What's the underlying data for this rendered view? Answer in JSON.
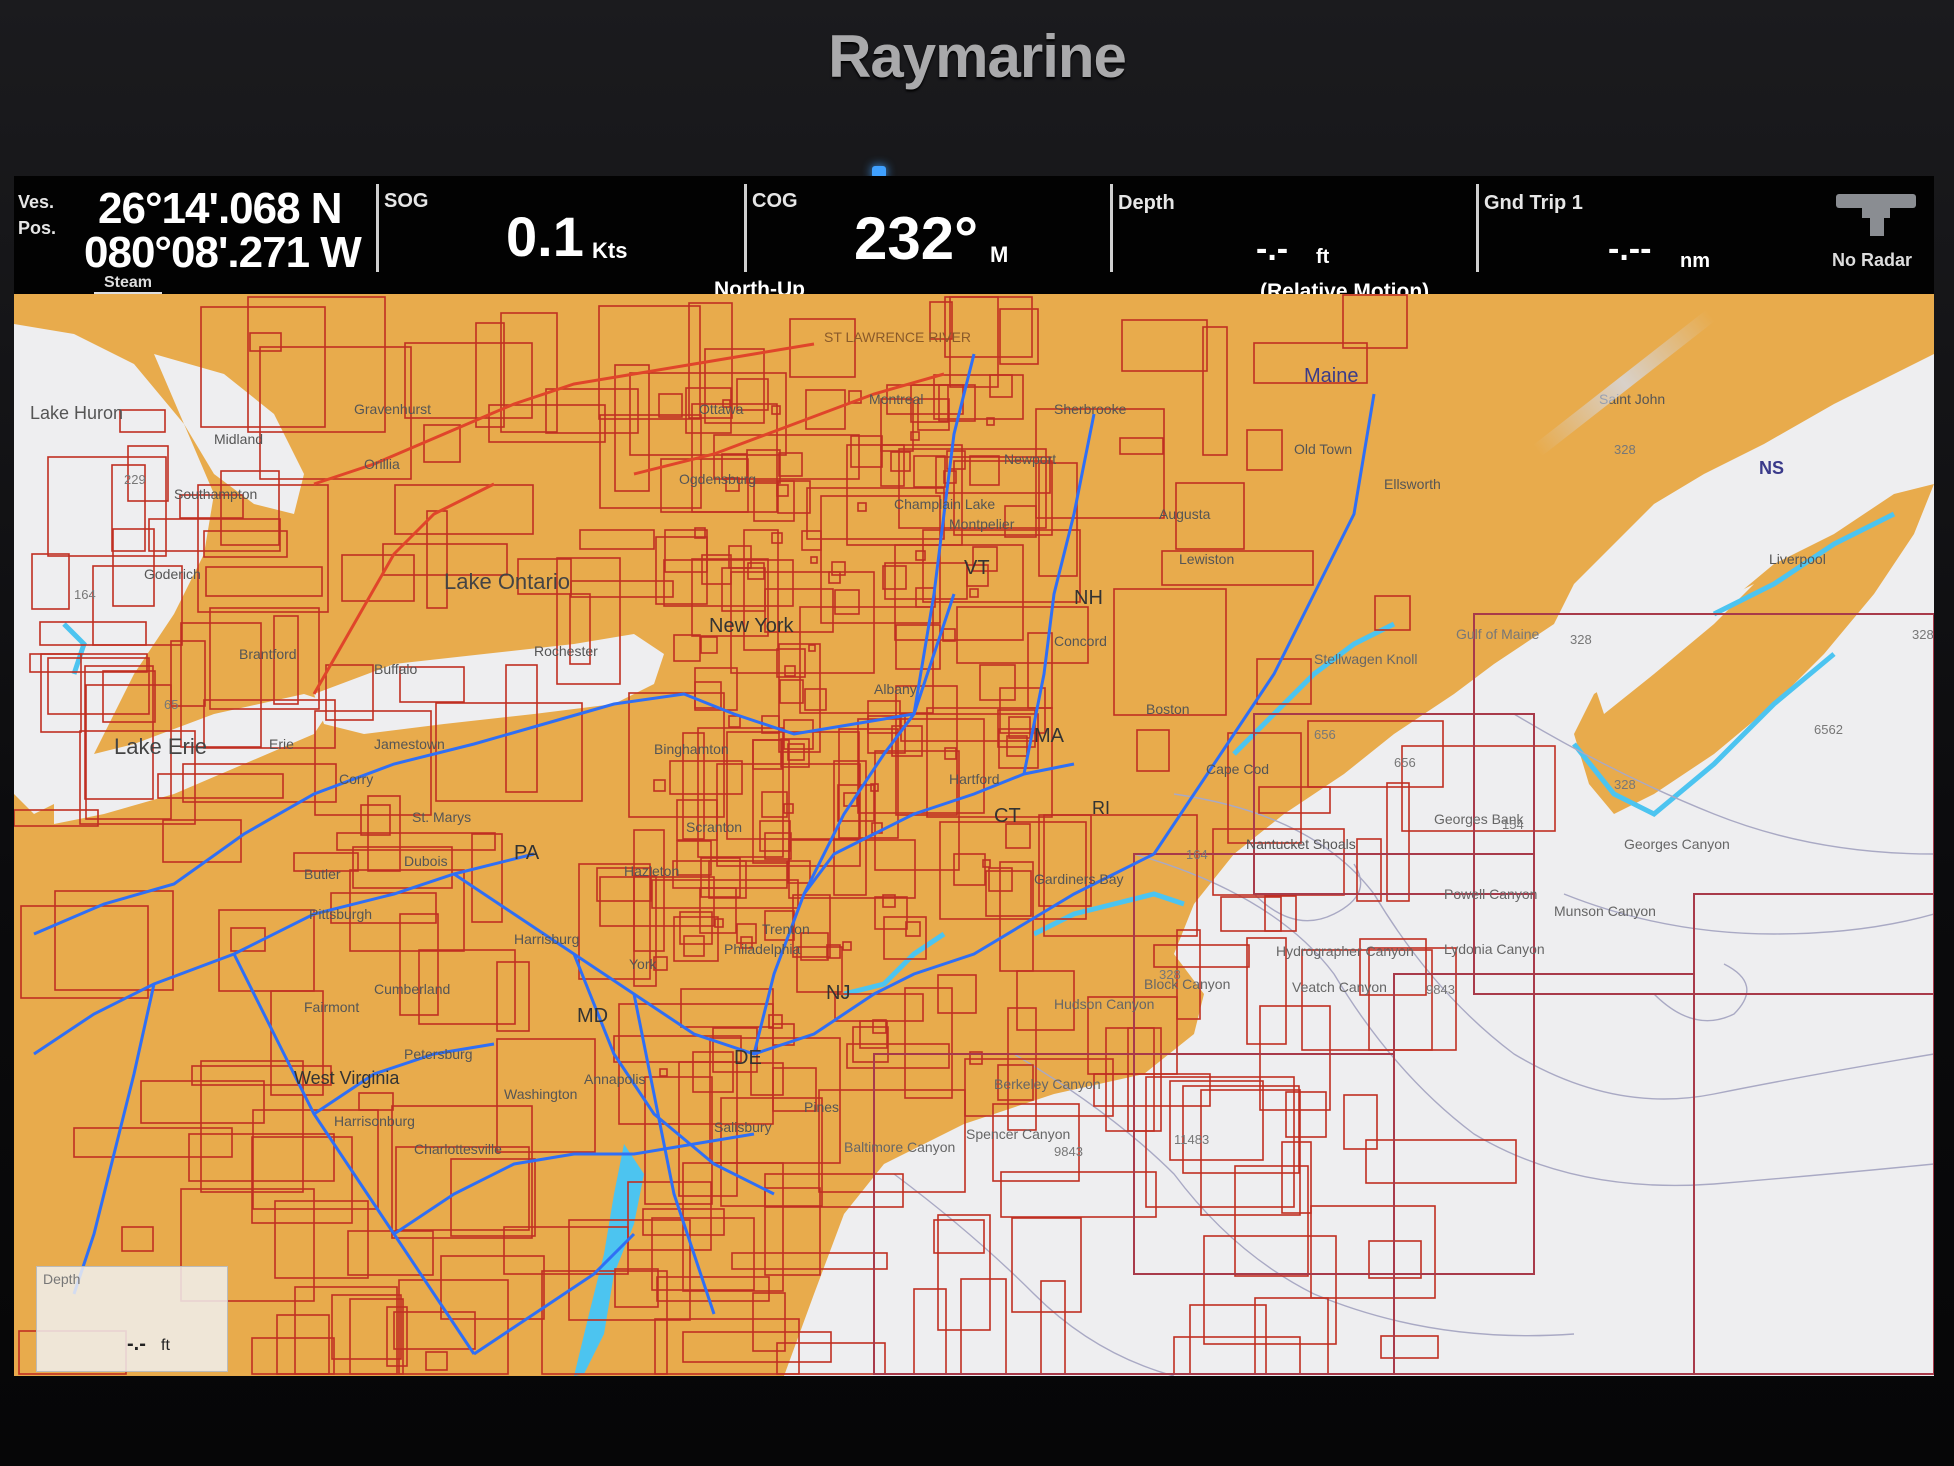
{
  "device": {
    "brand": "Raymarine"
  },
  "databar": {
    "position": {
      "label_line1": "Ves.",
      "label_line2": "Pos.",
      "lat": "26°14'.068 N",
      "lon": "080°08'.271 W",
      "tab": "Steam"
    },
    "sog": {
      "label": "SOG",
      "value": "0.1",
      "unit": "Kts"
    },
    "cog": {
      "label": "COG",
      "value": "232°",
      "unit": "M",
      "mode": "North-Up"
    },
    "depth": {
      "label": "Depth",
      "value": "-.-",
      "unit": "ft",
      "mode": "(Relative Motion)"
    },
    "trip": {
      "label": "Gnd Trip 1",
      "value": "-.--",
      "unit": "nm"
    },
    "radar": {
      "label": "No Radar",
      "icon": "radar-icon"
    }
  },
  "depth_box": {
    "label": "Depth",
    "value": "-.-",
    "unit": "ft"
  },
  "map": {
    "colors": {
      "land": "#e8ab4c",
      "water": "#eeeef0",
      "shallow": "#4cc4f0",
      "roads": "#2f6ff5",
      "charts": "#c02f22"
    },
    "labels": {
      "lake_huron": "Lake Huron",
      "huron_depth": "229",
      "midland": "Midland",
      "gravenhurst": "Gravenhurst",
      "orillia": "Orillia",
      "southampton": "Southampton",
      "goderich": "Goderich",
      "huron_164": "164",
      "brantford": "Brantford",
      "lake_ontario": "Lake Ontario",
      "lake_erie": "Lake Erie",
      "erie_65": "65",
      "buffalo": "Buffalo",
      "erie_city": "Erie",
      "jamestown": "Jamestown",
      "corry": "Corry",
      "rochester": "Rochester",
      "st_lawrence": "ST LAWRENCE RIVER",
      "ottawa": "Ottawa",
      "montreal": "Montreal",
      "ogdensburg": "Ogdensburg",
      "sherbrooke": "Sherbrooke",
      "newport": "Newport",
      "champlain": "Champlain Lake",
      "montpelier": "Montpelier",
      "maine": "Maine",
      "old_town": "Old Town",
      "augusta": "Augusta",
      "lewiston": "Lewiston",
      "ellsworth": "Ellsworth",
      "saint_john": "Saint John",
      "ns": "NS",
      "liverpool": "Liverpool",
      "vt": "VT",
      "nh": "NH",
      "new_york": "New York",
      "concord": "Concord",
      "albany": "Albany",
      "binghamton": "Binghamton",
      "ma": "MA",
      "hartford": "Hartford",
      "ct": "CT",
      "ri": "RI",
      "boston": "Boston",
      "cape_cod": "Cape Cod",
      "nantucket": "Nantucket Shoals",
      "gardiners": "Gardiners Bay",
      "scranton": "Scranton",
      "hazleton": "Hazleton",
      "pa": "PA",
      "st_marys": "St. Marys",
      "dubois": "Dubois",
      "butler": "Butler",
      "pittsburgh": "Pittsburgh",
      "harrisburg": "Harrisburg",
      "york": "York",
      "trenton": "Trenton",
      "philadelphia": "Philadelphia",
      "nj": "NJ",
      "cumberland": "Cumberland",
      "fairmont": "Fairmont",
      "md": "MD",
      "petersburg": "Petersburg",
      "west_virginia": "West Virginia",
      "washington": "Washington",
      "annapolis": "Annapolis",
      "harrisonburg": "Harrisonburg",
      "charlottesville": "Charlottesville",
      "de": "DE",
      "salisbury": "Salisbury",
      "pines": "Pines",
      "gulf_of_maine": "Gulf of Maine",
      "d_328a": "328",
      "d_328b": "328",
      "d_328c": "328",
      "d_328d": "328",
      "d_328e": "328",
      "stellwagen": "Stellwagen Knoll",
      "d_656a": "656",
      "d_656b": "656",
      "d_6562": "6562",
      "georges_bank": "Georges Bank",
      "d_154": "154",
      "d_164": "164",
      "georges_canyon": "Georges Canyon",
      "powell": "Powell Canyon",
      "munson": "Munson Canyon",
      "lydonia": "Lydonia Canyon",
      "hydrographer": "Hydrographer Canyon",
      "veatch": "Veatch Canyon",
      "block": "Block Canyon",
      "hudson": "Hudson Canyon",
      "d_9843a": "9843",
      "d_9843b": "9843",
      "berkeley": "Berkeley Canyon",
      "spencer": "Spencer Canyon",
      "baltimore": "Baltimore Canyon",
      "d_11483": "11483"
    }
  }
}
